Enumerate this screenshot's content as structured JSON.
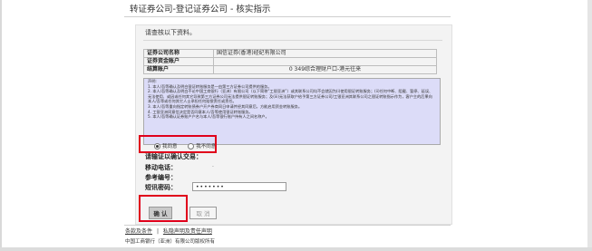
{
  "page": {
    "title": "转证券公司-登记证券公司 - 核实指示"
  },
  "intro": "请查核以下资料。",
  "info": {
    "rows": [
      {
        "label": "证券公司名称",
        "value": "国信证券(香港)经纪有限公司"
      },
      {
        "label": "证券资金账户",
        "value": ""
      },
      {
        "label": "结算账户",
        "value": "0 349综合理财户口-港元往来"
      }
    ]
  },
  "declaration": {
    "heading": "声明:",
    "paragraphs": [
      "1. 本人/吾等确认及明白银证转账服务是一由第三方证券公司提供的服务。",
      "2. 本人/吾等确认及明白不论中国工商银行（亚洲）有限公司（以下简称“工银亚洲”）或其联系公司均不会就因为(i)使用银证转账服务；(ii)任何中断、阻截、暂停、延误、无法使用、或因或任何其它导致第三方证券公司无法提供银证转账服务；及(iii)无法获取户给予第三方证券公司/工银亚洲其联系公司之银证转账指示作为，客户主的后果向本人/吾等或任何其它人士承担任何赔偿责任或责任。",
      "3. 本人/吾等重向指定转账债券户开户券商同日申请并经其同意后，方能启用资金转账服务。",
      "4. 工银亚洲同意信决定是否同意本人/吾等使用银证转账服务。",
      "5. 本人/吾等确认证券账户户名与本人/吾等银行账户持有人之间名称户。"
    ],
    "agree_label": "我同意",
    "disagree_label": "我不同意",
    "selected": "agree"
  },
  "fields": {
    "exchange_ref_label": "请输证以确认交易：",
    "mobile_label": "移动电话：",
    "ref_no_label": "参考编号：",
    "sms_label": "短讯密码：",
    "sms_value": "•••••••"
  },
  "buttons": {
    "confirm": "确 认",
    "cancel": "取 消"
  },
  "footer": {
    "link1": "条款及条件",
    "separator": "|",
    "link2": "私隐声明及责任声明",
    "copyright": "中国工商银行（亚洲）有限公司版权所有"
  },
  "colors": {
    "highlight": "#e0001b",
    "declaration_bg": "#dcdcf8"
  }
}
